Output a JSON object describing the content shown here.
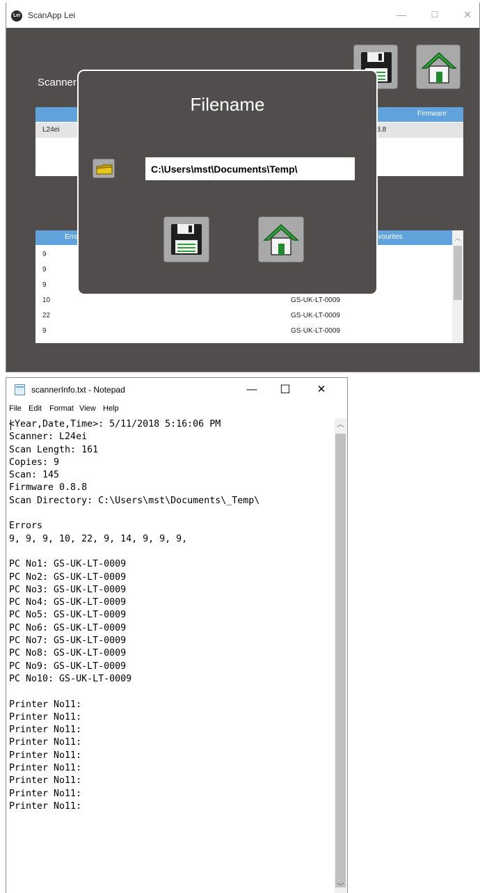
{
  "app": {
    "logo_text": "Lei",
    "title": "ScanApp Lei",
    "minimize_glyph": "—",
    "maximize_glyph": "☐",
    "close_glyph": "✕",
    "save_icon": "floppy-disk-icon",
    "home_icon": "home-icon",
    "scanner_label": "Scanner",
    "scanner_grid": {
      "columns": [
        "Firmware"
      ],
      "rows": [
        {
          "name": "L24ei",
          "firmware": "0.8.8"
        }
      ]
    },
    "errors_grid": {
      "columns": [
        "Errors",
        "Favourites"
      ],
      "rows": [
        {
          "errors": "9",
          "pc": ""
        },
        {
          "errors": "9",
          "pc": ""
        },
        {
          "errors": "9",
          "pc": ""
        },
        {
          "errors": "10",
          "pc": "GS-UK-LT-0009"
        },
        {
          "errors": "22",
          "pc": "GS-UK-LT-0009"
        },
        {
          "errors": "9",
          "pc": "GS-UK-LT-0009"
        }
      ]
    },
    "dialog": {
      "title": "Filename",
      "folder_icon": "folder-icon",
      "path_value": "C:\\Users\\mst\\Documents\\Temp\\",
      "save_icon": "floppy-disk-icon",
      "home_icon": "home-icon"
    }
  },
  "notepad": {
    "title": "scannerInfo.txt - Notepad",
    "minimize_glyph": "—",
    "maximize_glyph": "☐",
    "close_glyph": "✕",
    "menu": [
      "File",
      "Edit",
      "Format",
      "View",
      "Help"
    ],
    "lines": [
      "<Year,Date,Time>: 5/11/2018 5:16:06 PM",
      "Scanner: L24ei",
      "Scan Length: 161",
      "Copies: 9",
      "Scan: 145",
      "Firmware 0.8.8",
      "Scan Directory: C:\\Users\\mst\\Documents\\_Temp\\",
      "",
      "Errors",
      "9, 9, 9, 10, 22, 9, 14, 9, 9, 9,",
      "",
      "PC No1: GS-UK-LT-0009",
      "PC No2: GS-UK-LT-0009",
      "PC No3: GS-UK-LT-0009",
      "PC No4: GS-UK-LT-0009",
      "PC No5: GS-UK-LT-0009",
      "PC No6: GS-UK-LT-0009",
      "PC No7: GS-UK-LT-0009",
      "PC No8: GS-UK-LT-0009",
      "PC No9: GS-UK-LT-0009",
      "PC No10: GS-UK-LT-0009",
      "",
      "Printer No11:",
      "Printer No11:",
      "Printer No11:",
      "Printer No11:",
      "Printer No11:",
      "Printer No11:",
      "Printer No11:",
      "Printer No11:",
      "Printer No11:"
    ]
  }
}
